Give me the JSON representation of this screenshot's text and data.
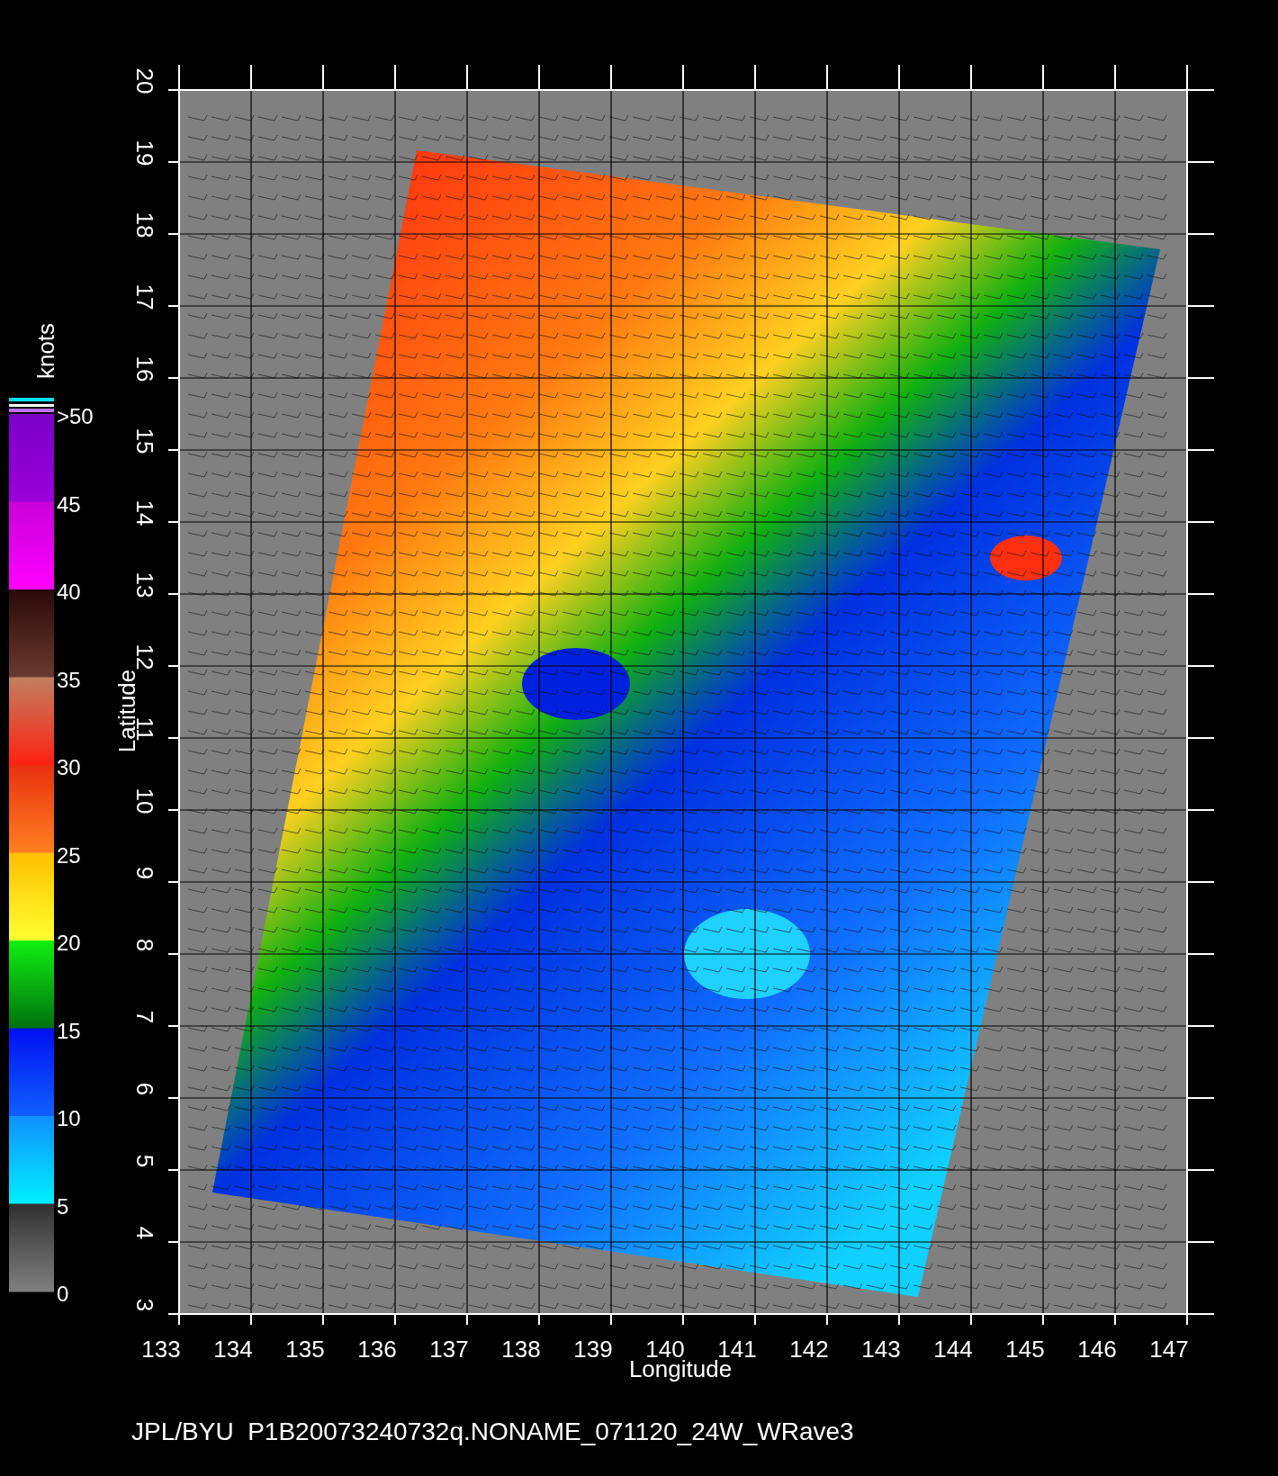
{
  "x_axis": {
    "label": "Longitude",
    "ticks": [
      "133",
      "134",
      "135",
      "136",
      "137",
      "138",
      "139",
      "140",
      "141",
      "142",
      "143",
      "144",
      "145",
      "146",
      "147"
    ]
  },
  "y_axis": {
    "label": "Latitude",
    "ticks": [
      "3",
      "4",
      "5",
      "6",
      "7",
      "8",
      "9",
      "10",
      "11",
      "12",
      "13",
      "14",
      "15",
      "16",
      "17",
      "18",
      "19",
      "20"
    ]
  },
  "colorbar": {
    "unit": "knots",
    "labels": [
      ">50",
      "45",
      "40",
      "35",
      "30",
      "25",
      "20",
      "15",
      "10",
      "5",
      "0"
    ]
  },
  "caption": "JPL/BYU  P1B20073240732q.NONAME_071120_24W_WRave3"
}
